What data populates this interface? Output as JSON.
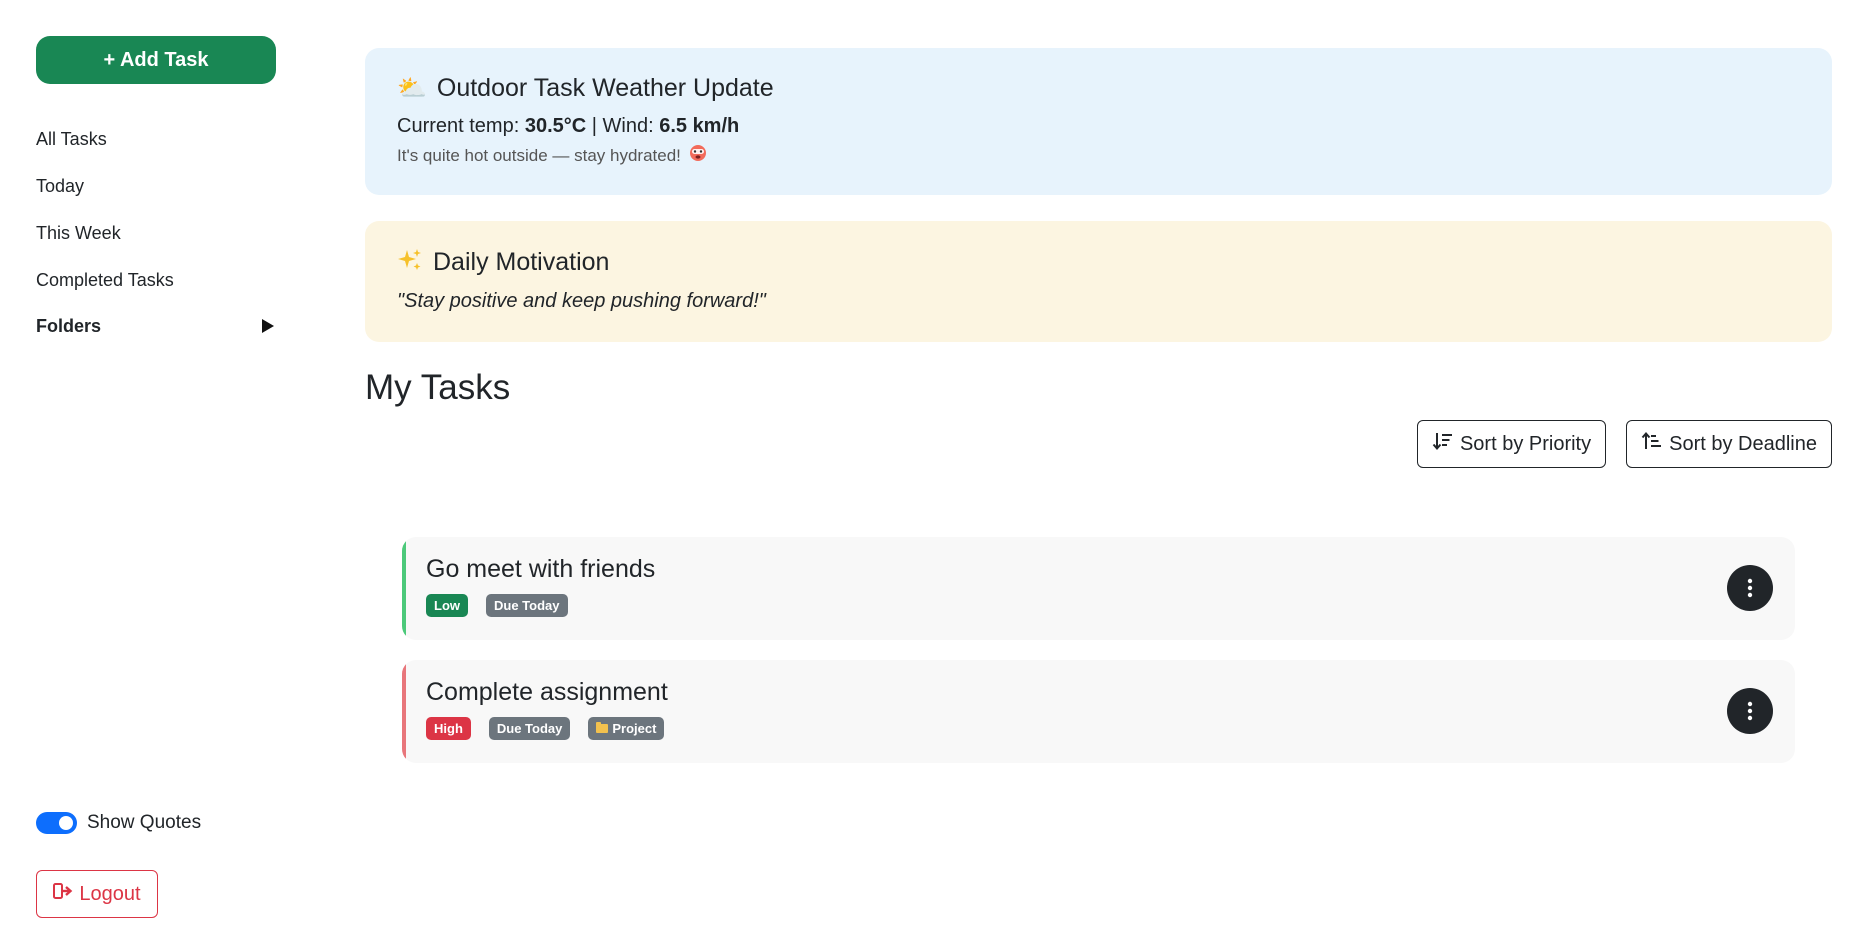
{
  "sidebar": {
    "add_task_label": "+ Add Task",
    "nav_items": [
      {
        "label": "All Tasks"
      },
      {
        "label": "Today"
      },
      {
        "label": "This Week"
      },
      {
        "label": "Completed Tasks"
      }
    ],
    "folders_label": "Folders",
    "show_quotes_label": "Show Quotes",
    "show_quotes_enabled": true,
    "logout_label": "Logout"
  },
  "weather": {
    "title": "Outdoor Task Weather Update",
    "icon": "sun-behind-cloud-icon",
    "temp_label": "Current temp:",
    "temp_value": "30.5°C",
    "separator": " | ",
    "wind_label": "Wind:",
    "wind_value": "6.5 km/h",
    "note": "It's quite hot outside — stay hydrated!",
    "note_icon": "hot-face-icon"
  },
  "motivation": {
    "title": "Daily Motivation",
    "icon": "sparkles-icon",
    "quote": "\"Stay positive and keep pushing forward!\""
  },
  "tasks_section": {
    "title": "My Tasks",
    "sort_priority_label": "Sort by Priority",
    "sort_deadline_label": "Sort by Deadline"
  },
  "tasks": [
    {
      "title": "Go meet with friends",
      "priority": "Low",
      "due": "Due Today",
      "folder": null
    },
    {
      "title": "Complete assignment",
      "priority": "High",
      "due": "Due Today",
      "folder": "Project"
    }
  ],
  "colors": {
    "primary_green": "#198754",
    "low_priority": "#198754",
    "high_priority": "#dc3545",
    "due_badge": "#6c757d",
    "toggle_blue": "#0d6efd",
    "weather_bg": "#e7f3fc",
    "motivation_bg": "#fcf5e1",
    "low_accent": "#4cc97a",
    "high_accent": "#e8767b"
  }
}
